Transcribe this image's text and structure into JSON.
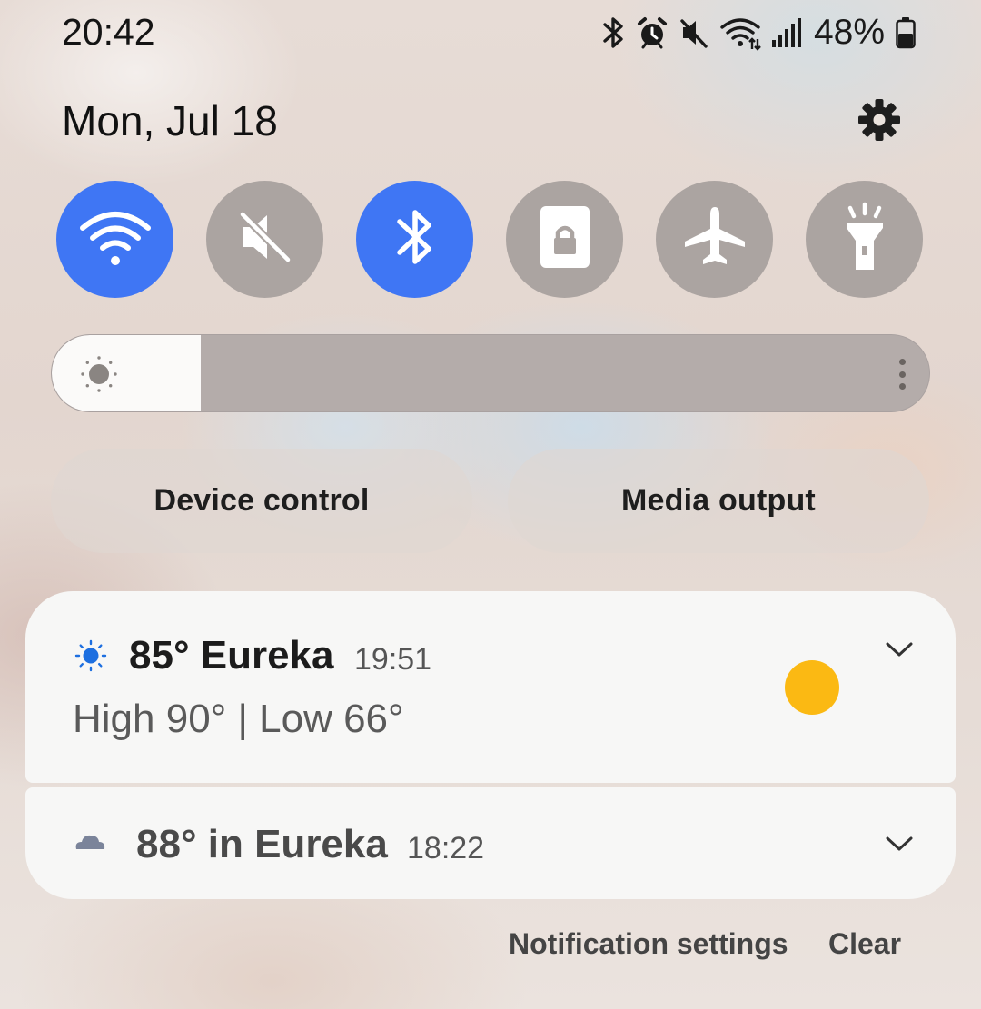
{
  "status_bar": {
    "time": "20:42",
    "battery_text": "48%",
    "icons": [
      "bluetooth-icon",
      "alarm-icon",
      "mute-icon",
      "wifi-icon",
      "signal-icon",
      "battery-icon"
    ]
  },
  "header": {
    "date": "Mon, Jul 18",
    "settings_icon": "gear-icon"
  },
  "quick_toggles": [
    {
      "id": "wifi",
      "icon": "wifi-icon",
      "state": "on"
    },
    {
      "id": "sound",
      "icon": "mute-icon",
      "state": "off"
    },
    {
      "id": "bluetooth",
      "icon": "bluetooth-icon",
      "state": "on"
    },
    {
      "id": "rotation-lock",
      "icon": "portrait-lock-icon",
      "state": "off"
    },
    {
      "id": "airplane",
      "icon": "airplane-icon",
      "state": "off"
    },
    {
      "id": "flashlight",
      "icon": "flashlight-icon",
      "state": "off"
    }
  ],
  "brightness": {
    "level": 0.17,
    "icon": "sun-icon"
  },
  "buttons": {
    "device_control": "Device control",
    "media_output": "Media output"
  },
  "notifications": [
    {
      "title": "85° Eureka",
      "time": "19:51",
      "body": "High 90° | Low 66°",
      "icon": "sun-icon"
    },
    {
      "title": "88° in Eureka",
      "time": "18:22",
      "icon": "cloud-icon"
    }
  ],
  "footer": {
    "notification_settings": "Notification settings",
    "clear": "Clear"
  },
  "colors": {
    "toggle_on": "#3f76f4",
    "toggle_off": "#aba4a1",
    "sun": "#fbb913"
  }
}
